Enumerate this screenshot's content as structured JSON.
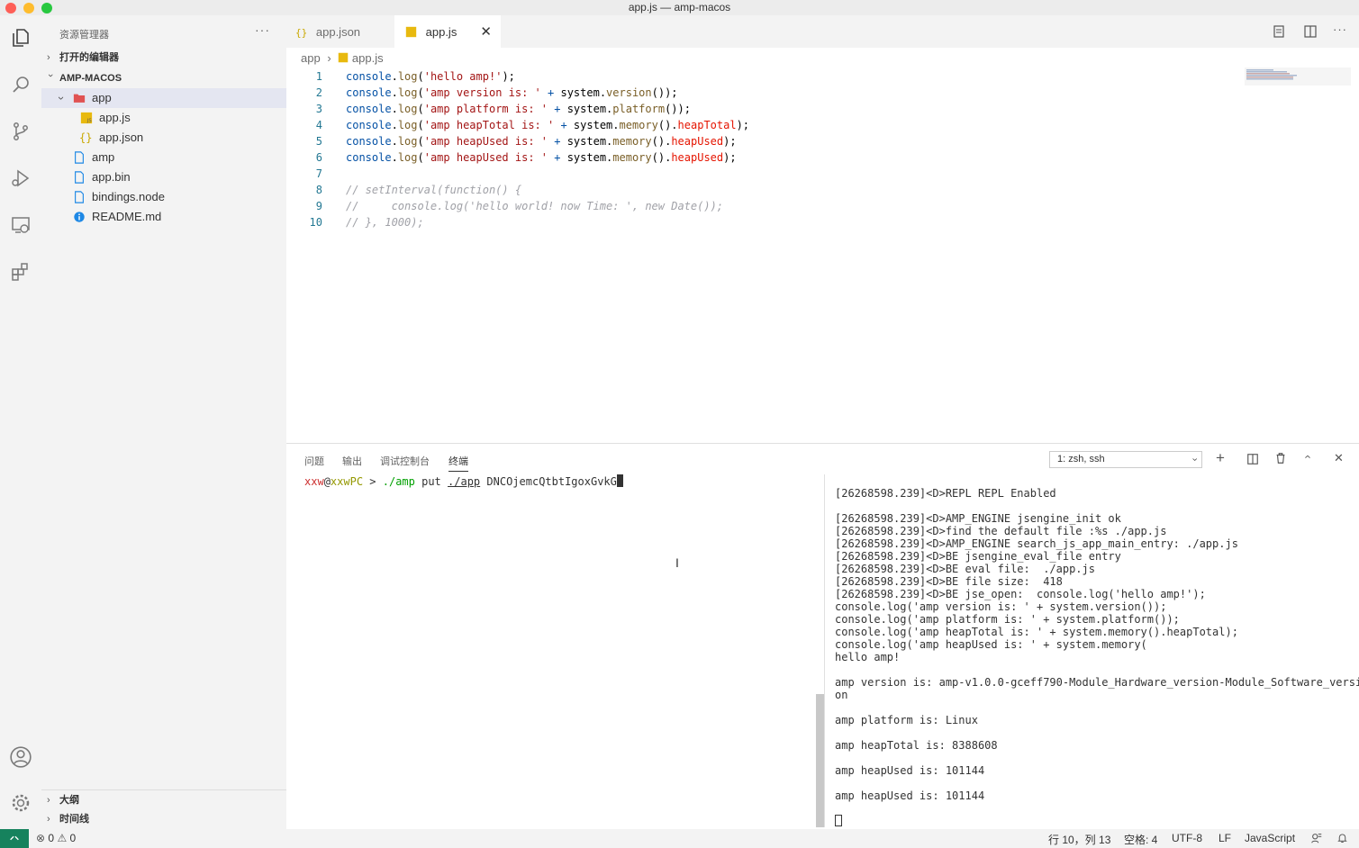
{
  "window": {
    "title": "app.js — amp-macos"
  },
  "colors": {
    "accent": "#007acc",
    "tab_active": "#ffffff",
    "js_icon": "#e8b90f",
    "folder_red": "#e05252",
    "file_blue": "#1e88e5"
  },
  "activity_bar": {
    "items": [
      "files-icon",
      "search-icon",
      "source-control-icon",
      "run-debug-icon",
      "remote-explorer-icon",
      "extensions-icon"
    ],
    "bottom": [
      "account-icon",
      "settings-gear-icon"
    ]
  },
  "sidebar": {
    "header": "资源管理器",
    "more": "···",
    "open_editors": "打开的编辑器",
    "project": "AMP-MACOS",
    "tree": [
      {
        "name": "app",
        "type": "folder",
        "depth": 1
      },
      {
        "name": "app.js",
        "type": "js",
        "depth": 2
      },
      {
        "name": "app.json",
        "type": "json",
        "depth": 2
      },
      {
        "name": "amp",
        "type": "file",
        "depth": 1
      },
      {
        "name": "app.bin",
        "type": "file",
        "depth": 1
      },
      {
        "name": "bindings.node",
        "type": "file",
        "depth": 1
      },
      {
        "name": "README.md",
        "type": "info",
        "depth": 1
      }
    ],
    "outline": "大纲",
    "timeline": "时间线"
  },
  "tabs": [
    {
      "label": "app.json",
      "active": false
    },
    {
      "label": "app.js",
      "active": true
    }
  ],
  "breadcrumb": {
    "folder": "app",
    "file": "app.js"
  },
  "code_lines": [
    "console.log('hello amp!');",
    "console.log('amp version is: ' + system.version());",
    "console.log('amp platform is: ' + system.platform());",
    "console.log('amp heapTotal is: ' + system.memory().heapTotal);",
    "console.log('amp heapUsed is: ' + system.memory().heapUsed);",
    "console.log('amp heapUsed is: ' + system.memory().heapUsed);",
    "",
    "// setInterval(function() {",
    "//     console.log('hello world! now Time: ', new Date());",
    "// }, 1000);"
  ],
  "panel": {
    "tabs": [
      "问题",
      "输出",
      "调试控制台",
      "终端"
    ],
    "active_tab": "终端",
    "terminal_select": "1: zsh, ssh",
    "prompt_user": "xxw",
    "prompt_host": "xxwPC",
    "prompt_arrow": ">",
    "command": "./amp",
    "command_arg1": "put",
    "command_arg2": "./app",
    "command_arg3": "DNCOjemcQtbtIgoxGvkG",
    "output_lines": [
      "[26268598.239]<D>REPL REPL Enabled",
      "",
      "[26268598.239]<D>AMP_ENGINE jsengine_init ok",
      "[26268598.239]<D>find the default file :%s ./app.js",
      "[26268598.239]<D>AMP_ENGINE search_js_app_main_entry: ./app.js",
      "[26268598.239]<D>BE jsengine_eval_file entry",
      "[26268598.239]<D>BE eval file:  ./app.js",
      "[26268598.239]<D>BE file size:  418",
      "[26268598.239]<D>BE jse_open:  console.log('hello amp!');",
      "console.log('amp version is: ' + system.version());",
      "console.log('amp platform is: ' + system.platform());",
      "console.log('amp heapTotal is: ' + system.memory().heapTotal);",
      "console.log('amp heapUsed is: ' + system.memory(",
      "hello amp!",
      "",
      "amp version is: amp-v1.0.0-gceff790-Module_Hardware_version-Module_Software_versi",
      "on",
      "",
      "amp platform is: Linux",
      "",
      "amp heapTotal is: 8388608",
      "",
      "amp heapUsed is: 101144",
      "",
      "amp heapUsed is: 101144",
      ""
    ]
  },
  "statusbar": {
    "errors": "0",
    "warnings": "0",
    "position": "行 10，列 13",
    "indent": "空格: 4",
    "encoding": "UTF-8",
    "eol": "LF",
    "language": "JavaScript"
  }
}
